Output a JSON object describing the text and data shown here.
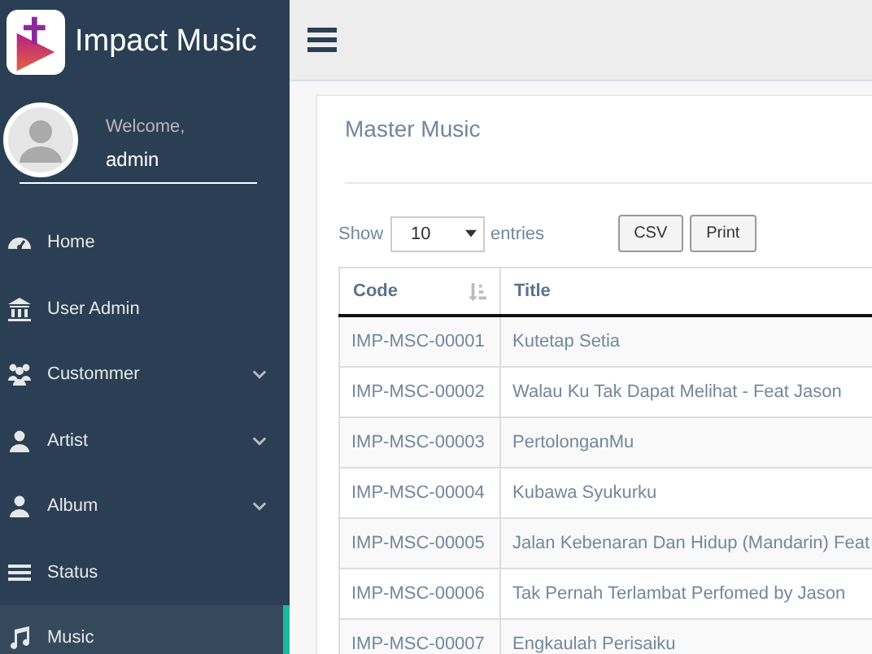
{
  "sidebar": {
    "brand": "Impact Music",
    "welcome": "Welcome,",
    "user": "admin",
    "items": [
      {
        "label": "Home",
        "expandable": false,
        "selected": false
      },
      {
        "label": "User Admin",
        "expandable": false,
        "selected": false
      },
      {
        "label": "Custommer",
        "expandable": true,
        "selected": false
      },
      {
        "label": "Artist",
        "expandable": true,
        "selected": false
      },
      {
        "label": "Album",
        "expandable": true,
        "selected": false
      },
      {
        "label": "Status",
        "expandable": false,
        "selected": false
      },
      {
        "label": "Music",
        "expandable": false,
        "selected": true
      }
    ]
  },
  "panel": {
    "title": "Master Music",
    "show_label": "Show",
    "page_size": "10",
    "entries_label": "entries",
    "buttons": [
      "CSV",
      "Print"
    ],
    "table": {
      "columns": [
        "Code",
        "Title"
      ],
      "rows": [
        [
          "IMP-MSC-00001",
          "Kutetap Setia"
        ],
        [
          "IMP-MSC-00002",
          "Walau Ku Tak Dapat Melihat - Feat Jason"
        ],
        [
          "IMP-MSC-00003",
          "PertolonganMu"
        ],
        [
          "IMP-MSC-00004",
          "Kubawa Syukurku"
        ],
        [
          "IMP-MSC-00005",
          "Jalan Kebenaran Dan Hidup (Mandarin) Feat"
        ],
        [
          "IMP-MSC-00006",
          "Tak Pernah Terlambat Perfomed by Jason"
        ],
        [
          "IMP-MSC-00007",
          "Engkaulah Perisaiku"
        ]
      ]
    }
  }
}
